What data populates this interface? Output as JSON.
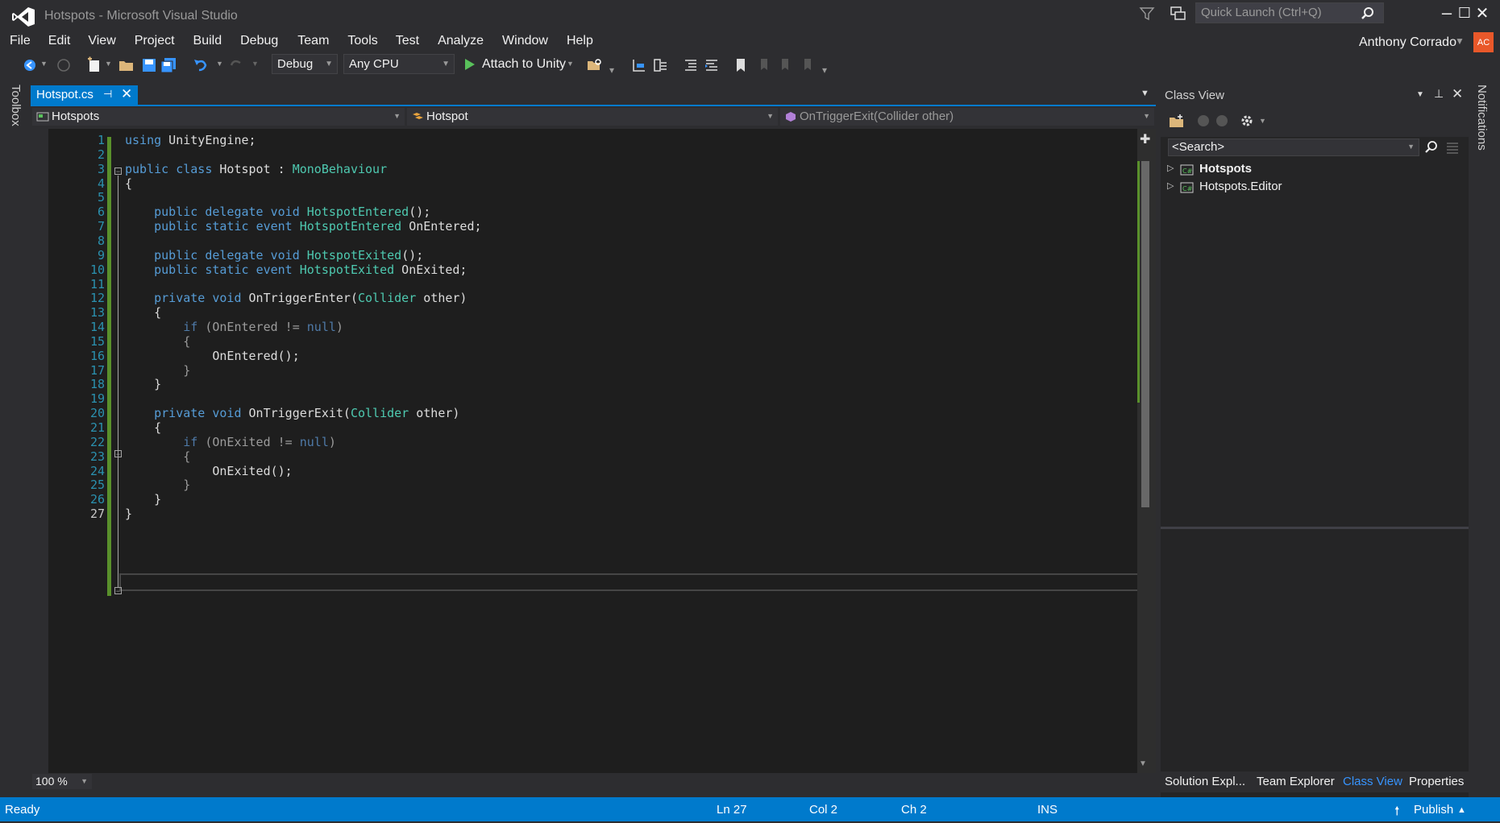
{
  "window": {
    "title": "Hotspots - Microsoft Visual Studio",
    "quick_launch_placeholder": "Quick Launch (Ctrl+Q)",
    "minimize": "–",
    "maximize": "☐",
    "close": "✕"
  },
  "menu": [
    "File",
    "Edit",
    "View",
    "Project",
    "Build",
    "Debug",
    "Team",
    "Tools",
    "Test",
    "Analyze",
    "Window",
    "Help"
  ],
  "user": {
    "name": "Anthony Corrado",
    "initials": "AC"
  },
  "toolbar": {
    "configuration": "Debug",
    "platform": "Any CPU",
    "attach": "Attach to Unity"
  },
  "toolbox_label": "Toolbox",
  "notifications_label": "Notifications",
  "document_tab": {
    "label": "Hotspot.cs"
  },
  "navbar": {
    "project": "Hotspots",
    "type": "Hotspot",
    "member": "OnTriggerExit(Collider other)"
  },
  "code": [
    {
      "n": "1",
      "t": "using UnityEngine;"
    },
    {
      "n": "2",
      "t": ""
    },
    {
      "n": "3",
      "t": "public class Hotspot : MonoBehaviour"
    },
    {
      "n": "4",
      "t": "{"
    },
    {
      "n": "5",
      "t": ""
    },
    {
      "n": "6",
      "t": "    public delegate void HotspotEntered();"
    },
    {
      "n": "7",
      "t": "    public static event HotspotEntered OnEntered;"
    },
    {
      "n": "8",
      "t": ""
    },
    {
      "n": "9",
      "t": "    public delegate void HotspotExited();"
    },
    {
      "n": "10",
      "t": "    public static event HotspotExited OnExited;"
    },
    {
      "n": "11",
      "t": ""
    },
    {
      "n": "12",
      "t": "    private void OnTriggerEnter(Collider other)"
    },
    {
      "n": "13",
      "t": "    {"
    },
    {
      "n": "14",
      "t": "        if (OnEntered != null)"
    },
    {
      "n": "15",
      "t": "        {"
    },
    {
      "n": "16",
      "t": "            OnEntered();"
    },
    {
      "n": "17",
      "t": "        }"
    },
    {
      "n": "18",
      "t": "    }"
    },
    {
      "n": "19",
      "t": ""
    },
    {
      "n": "20",
      "t": "    private void OnTriggerExit(Collider other)"
    },
    {
      "n": "21",
      "t": "    {"
    },
    {
      "n": "22",
      "t": "        if (OnExited != null)"
    },
    {
      "n": "23",
      "t": "        {"
    },
    {
      "n": "24",
      "t": "            OnExited();"
    },
    {
      "n": "25",
      "t": "        }"
    },
    {
      "n": "26",
      "t": "    }"
    },
    {
      "n": "27",
      "t": "}"
    }
  ],
  "zoom": "100 %",
  "class_view": {
    "title": "Class View",
    "search_placeholder": "<Search>",
    "items": [
      "Hotspots",
      "Hotspots.Editor"
    ]
  },
  "panel_tabs": [
    "Solution Expl...",
    "Team Explorer",
    "Class View",
    "Properties"
  ],
  "status": {
    "state": "Ready",
    "ln": "Ln 27",
    "col": "Col 2",
    "ch": "Ch 2",
    "mode": "INS",
    "publish": "Publish"
  },
  "colors": {
    "accent": "#007acc",
    "background": "#2d2d30",
    "editor": "#1e1e1e",
    "keyword": "#569cd6",
    "type": "#4ec9b0",
    "line_number": "#2b91af",
    "change_bar": "#59902b"
  }
}
